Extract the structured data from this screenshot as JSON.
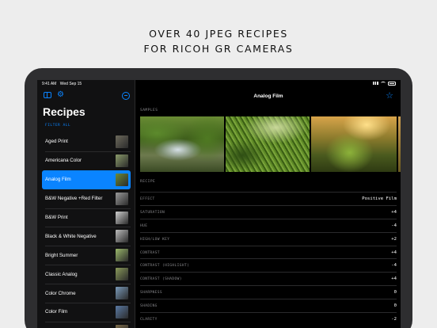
{
  "headline": {
    "line1": "OVER 40 JPEG RECIPES",
    "line2": "FOR RICOH GR CAMERAS"
  },
  "status_bar": {
    "time": "9:41 AM",
    "date": "Wed Sep 15"
  },
  "sidebar": {
    "title": "Recipes",
    "filter_label": "FILTER ALL",
    "items": [
      {
        "label": "Aged Print",
        "thumb": "#6d6a5c"
      },
      {
        "label": "Americana Color",
        "thumb": "#8a9a6a"
      },
      {
        "label": "Analog Film",
        "thumb": "#6a8a3a",
        "selected": true
      },
      {
        "label": "B&W Negative +Red Filter",
        "thumb": "#9a9a9a"
      },
      {
        "label": "B&W Print",
        "thumb": "#cfcfcf"
      },
      {
        "label": "Black & White Negative",
        "thumb": "#bdbdbd"
      },
      {
        "label": "Bright Summer",
        "thumb": "#9ab86a"
      },
      {
        "label": "Classic Analog",
        "thumb": "#8a9a5a"
      },
      {
        "label": "Color Chrome",
        "thumb": "#7a9aba"
      },
      {
        "label": "Color Film",
        "thumb": "#5a7aa4"
      },
      {
        "label": "",
        "thumb": "#7a6a4a"
      }
    ]
  },
  "detail": {
    "title": "Analog Film",
    "samples_label": "SAMPLES",
    "recipe_label": "RECIPE",
    "rows": [
      {
        "key": "EFFECT",
        "value": "Positive Film"
      },
      {
        "key": "SATURATION",
        "value": "+4"
      },
      {
        "key": "HUE",
        "value": "-4"
      },
      {
        "key": "HIGH/LOW KEY",
        "value": "+2"
      },
      {
        "key": "CONTRAST",
        "value": "+4"
      },
      {
        "key": "CONTRAST (HIGHLIGHT)",
        "value": "-4"
      },
      {
        "key": "CONTRAST (SHADOW)",
        "value": "+4"
      },
      {
        "key": "SHARPNESS",
        "value": "0"
      },
      {
        "key": "SHADING",
        "value": "0"
      },
      {
        "key": "CLARITY",
        "value": "-2"
      }
    ]
  },
  "colors": {
    "accent": "#0a84ff",
    "background": "#000000",
    "sidebar": "#111112"
  },
  "icons": [
    "sidebar-toggle-icon",
    "gear-icon",
    "minus-circle-icon",
    "star-icon",
    "battery-icon",
    "wifi-icon",
    "signal-icon"
  ]
}
